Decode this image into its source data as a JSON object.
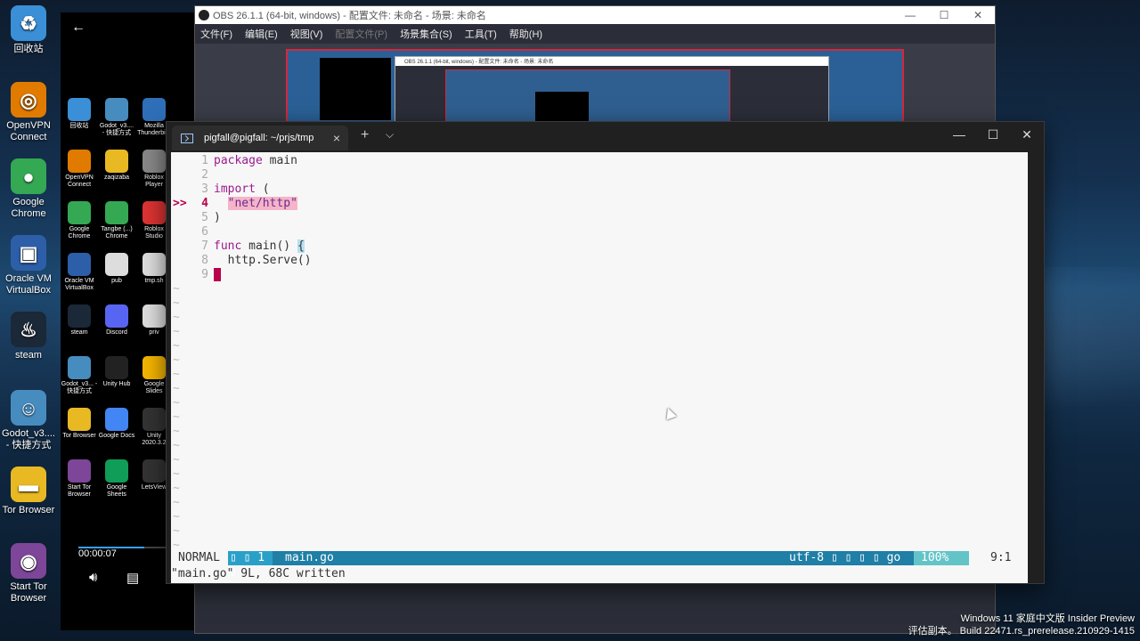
{
  "desktop": {
    "icons": [
      {
        "label": "回收站",
        "icon": "recycle-bin-icon"
      },
      {
        "label": "OpenVPN\nConnect",
        "icon": "openvpn-icon"
      },
      {
        "label": "Google\nChrome",
        "icon": "chrome-icon"
      },
      {
        "label": "Oracle VM\nVirtualBox",
        "icon": "virtualbox-icon"
      },
      {
        "label": "steam",
        "icon": "steam-icon"
      },
      {
        "label": "Godot_v3....\n- 快捷方式",
        "icon": "godot-icon"
      },
      {
        "label": "Tor Browser",
        "icon": "folder-icon"
      },
      {
        "label": "Start Tor\nBrowser",
        "icon": "tor-icon"
      }
    ],
    "small_icons": [
      {
        "label": "回收站",
        "icon": "recycle-bin-icon"
      },
      {
        "label": "Godot_v3.... - 快捷方式",
        "icon": "godot-icon"
      },
      {
        "label": "Mozilla Thunderbird",
        "icon": "thunderbird-icon"
      },
      {
        "label": "OpenVPN Connect",
        "icon": "openvpn-icon"
      },
      {
        "label": "zaqizaba",
        "icon": "folder-icon"
      },
      {
        "label": "Roblox Player",
        "icon": "roblox-icon"
      },
      {
        "label": "Google Chrome",
        "icon": "chrome-icon"
      },
      {
        "label": "Tangbe (...) Chrome",
        "icon": "chrome-icon"
      },
      {
        "label": "Roblox Studio",
        "icon": "roblox-studio-icon"
      },
      {
        "label": "Oracle VM VirtualBox",
        "icon": "virtualbox-icon"
      },
      {
        "label": "pub",
        "icon": "file-icon"
      },
      {
        "label": "tmp.sh",
        "icon": "file-icon"
      },
      {
        "label": "steam",
        "icon": "steam-icon"
      },
      {
        "label": "Discord",
        "icon": "discord-icon"
      },
      {
        "label": "priv",
        "icon": "file-icon"
      },
      {
        "label": "Godot_v3... - 快捷方式",
        "icon": "godot-icon"
      },
      {
        "label": "Unity Hub",
        "icon": "unity-icon"
      },
      {
        "label": "Google Slides",
        "icon": "slides-icon"
      },
      {
        "label": "Tor Browser",
        "icon": "folder-icon"
      },
      {
        "label": "Google Docs",
        "icon": "docs-icon"
      },
      {
        "label": "Unity 2020.3.2",
        "icon": "unity-icon"
      },
      {
        "label": "Start Tor Browser",
        "icon": "tor-icon"
      },
      {
        "label": "Google Sheets",
        "icon": "sheets-icon"
      },
      {
        "label": "LetsView",
        "icon": "letsview-icon"
      }
    ]
  },
  "player": {
    "time": "00:00:07",
    "progress": 0.62
  },
  "obs": {
    "title": "OBS 26.1.1 (64-bit, windows) - 配置文件: 未命名 - 场景: 未命名",
    "mini_title": "OBS 26.1.1 (64-bit, windows) - 配置文件: 未命名 - 场景: 未命名",
    "menu": [
      "文件(F)",
      "编辑(E)",
      "视图(V)",
      "配置文件(P)",
      "场景集合(S)",
      "工具(T)",
      "帮助(H)"
    ]
  },
  "terminal": {
    "tab_title": "pigfall@pigfall: ~/prjs/tmp",
    "new_tab": "+",
    "dropdown": "⌵"
  },
  "editor": {
    "lines": [
      {
        "num": "1",
        "text": "package main"
      },
      {
        "num": "2",
        "text": ""
      },
      {
        "num": "3",
        "text": "import ("
      },
      {
        "num": "4",
        "text": "\"net/http\"",
        "sign": ">>"
      },
      {
        "num": "5",
        "text": ")"
      },
      {
        "num": "6",
        "text": ""
      },
      {
        "num": "7",
        "text": "func main() {"
      },
      {
        "num": "8",
        "text": "http.Serve()"
      },
      {
        "num": "9",
        "text": ""
      }
    ],
    "status": {
      "mode": "NORMAL",
      "git": "▯ ▯ 1 ▯",
      "filename": "main.go",
      "encoding": "utf-8 ▯ ▯ ▯ ▯ go",
      "percent": "100%",
      "position": "9:1"
    },
    "cmdline": "\"main.go\" 9L, 68C written"
  },
  "watermark": {
    "line1": "Windows 11 家庭中文版 Insider Preview",
    "line2": "评估副本。 Build 22471.rs_prerelease.210929-1415"
  }
}
